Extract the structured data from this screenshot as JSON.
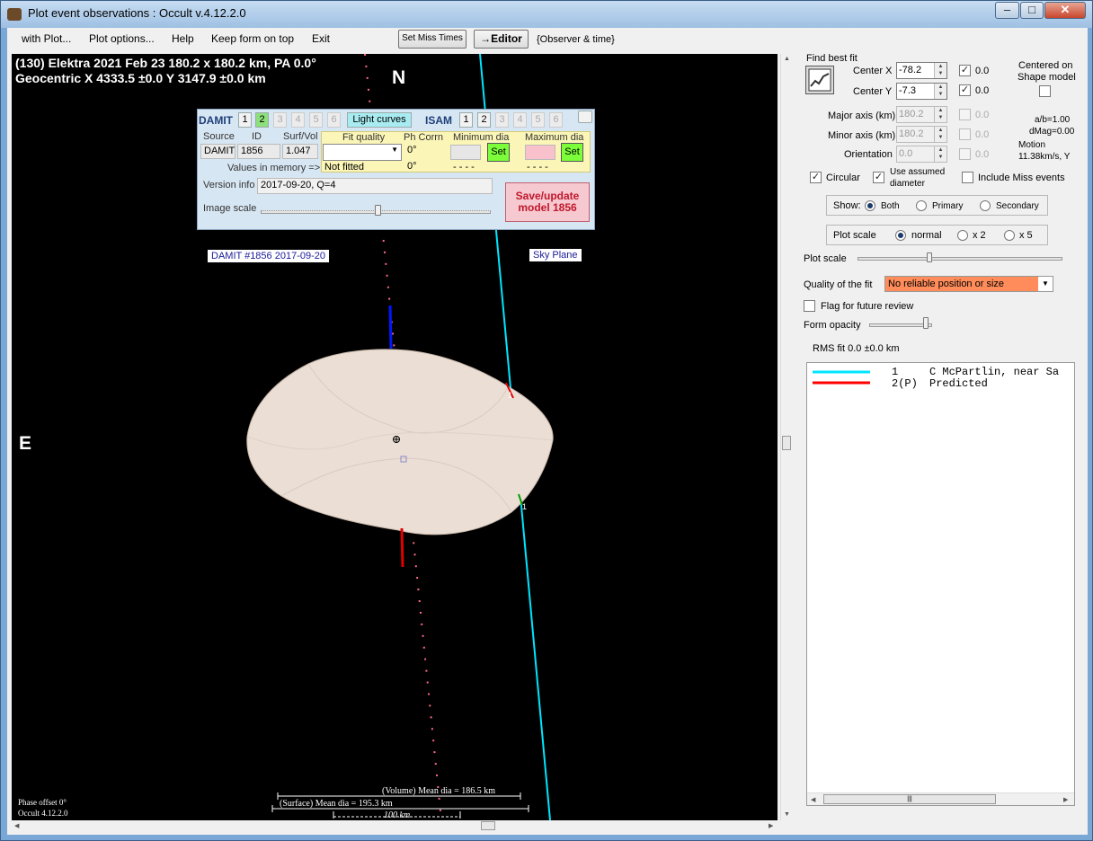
{
  "window": {
    "title": "Plot event observations : Occult v.4.12.2.0"
  },
  "menu": [
    "with Plot...",
    "Plot options...",
    "Help",
    "Keep form on top",
    "Exit"
  ],
  "toolbar": {
    "set_miss_times": "Set Miss Times",
    "editor": "→Editor",
    "observer_time": "{Observer & time}"
  },
  "plot": {
    "header1": "(130) Elektra  2021 Feb 23  180.2 x 180.2 km, PA 0.0°",
    "header2": "Geocentric  X 4333.5 ±0.0  Y 3147.9 ±0.0 km",
    "north": "N",
    "east": "E",
    "damit_tag": "DAMIT #1856 2017-09-20",
    "sky_plane": "Sky Plane",
    "chord_label": "1",
    "volume_mean": "(Volume) Mean dia = 186.5 km",
    "surface_mean": "(Surface) Mean dia = 195.3 km",
    "scale_label": "100 km",
    "phase_offset": "Phase offset 0°",
    "version": "Occult 4.12.2.0"
  },
  "damit_panel": {
    "damit_label": "DAMIT",
    "damit_buttons": [
      "1",
      "2",
      "3",
      "4",
      "5",
      "6"
    ],
    "light_curves": "Light curves",
    "isam_label": "ISAM",
    "isam_buttons": [
      "1",
      "2",
      "3",
      "4",
      "5",
      "6"
    ],
    "col_source": "Source",
    "col_id": "ID",
    "col_surfvol": "Surf/Vol",
    "source": "DAMIT",
    "id": "1856",
    "surfvol": "1.047",
    "values_in_memory": "Values in memory =>",
    "fit_quality_label": "Fit quality",
    "ph_corrn_label": "Ph Corrn",
    "min_dia_label": "Minimum dia",
    "max_dia_label": "Maximum dia",
    "ph_corrn_value": "0°",
    "ph_corrn_mem": "0°",
    "fit_quality_mem": "Not fitted",
    "min_dia_mem": "- - - -",
    "max_dia_mem": "- - - -",
    "set": "Set",
    "version_info_label": "Version info",
    "version_info": "2017-09-20, Q=4",
    "image_scale_label": "Image scale",
    "save_update": "Save/update",
    "save_model": "model  1856"
  },
  "right": {
    "find_best_fit": "Find best fit",
    "center_x_label": "Center X",
    "center_x": "-78.2",
    "center_x_val": "0.0",
    "center_y_label": "Center Y",
    "center_y": "-7.3",
    "center_y_val": "0.0",
    "centered_on": "Centered on",
    "shape_model": "Shape model",
    "major_axis_label": "Major axis (km)",
    "major_axis": "180.2",
    "major_axis_val": "0.0",
    "minor_axis_label": "Minor axis (km)",
    "minor_axis": "180.2",
    "minor_axis_val": "0.0",
    "orientation_label": "Orientation",
    "orientation": "0.0",
    "orientation_val": "0.0",
    "ab_ratio": "a/b=1.00",
    "dmag": "dMag=0.00",
    "motion_label": "Motion",
    "motion": "11.38km/s, Y",
    "circular": "Circular",
    "use_assumed1": "Use assumed",
    "use_assumed2": "diameter",
    "include_miss": "Include Miss events",
    "show_label": "Show:",
    "show_both": "Both",
    "show_primary": "Primary",
    "show_secondary": "Secondary",
    "plot_scale_group": "Plot scale",
    "scale_normal": "normal",
    "scale_x2": "x 2",
    "scale_x5": "x 5",
    "plot_scale_slider": "Plot scale",
    "quality_label": "Quality of the fit",
    "quality_value": "No reliable position or size",
    "flag_review": "Flag for future review",
    "form_opacity": "Form opacity",
    "rms_fit": "RMS fit 0.0 ±0.0 km",
    "list": [
      {
        "num": "1",
        "name": "C McPartlin, near Sa",
        "color": "#00e5ff"
      },
      {
        "num": "2(P)",
        "name": "Predicted",
        "color": "#ff0000"
      }
    ]
  },
  "colors": {
    "chord": "#00e5ff",
    "predicted": "#ff0000",
    "quality_bg": "#ff8c5a",
    "damit_panel": "#d7e6f3"
  }
}
